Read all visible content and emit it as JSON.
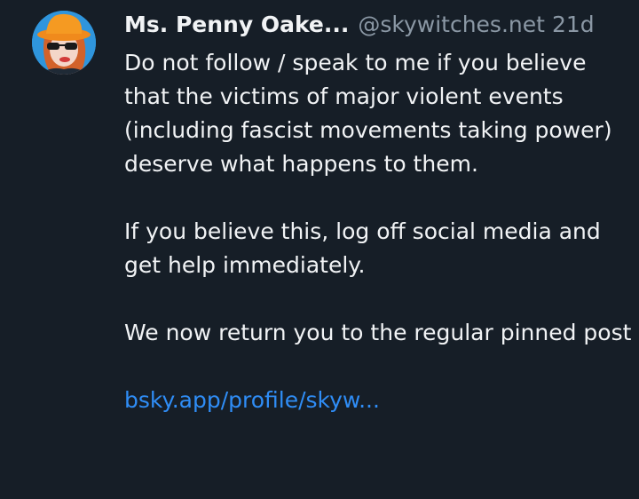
{
  "post": {
    "author": {
      "display_name": "Ms. Penny Oake...",
      "handle": "@skywitches.net",
      "avatar_icon": "avatar-woman-orange-hat-sunglasses"
    },
    "age": "21d",
    "paragraphs": [
      "Do not follow / speak to me if you believe that the victims of major violent events (including fascist movements taking power) deserve what happens to them.",
      "If you believe this, log off social media and get help immediately.",
      "We now return you to the regular pinned post"
    ],
    "link_text": "bsky.app/profile/skyw..."
  },
  "colors": {
    "background": "#161e27",
    "text": "#f1f3f5",
    "muted": "#8b98a5",
    "link": "#2f8df6"
  }
}
